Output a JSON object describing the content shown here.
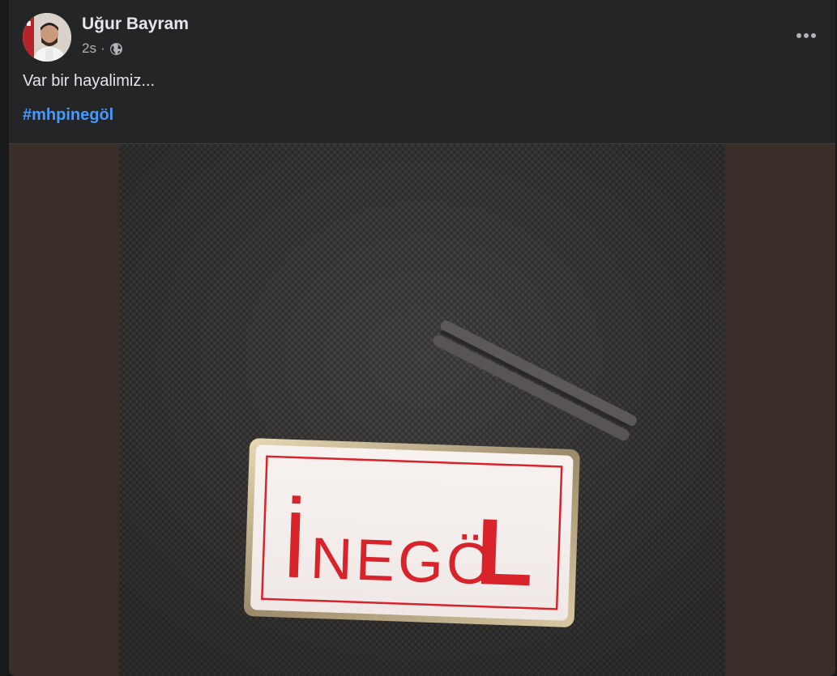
{
  "post": {
    "author": "Uğur Bayram",
    "time": "2s",
    "separator": "·",
    "text": "Var bir hayalimiz...",
    "hashtag": "#mhpinegöl"
  },
  "photo": {
    "pin_text_first": "İ",
    "pin_text_rest": "NEGÖ",
    "pin_text_last": "L"
  },
  "icons": {
    "privacy": "globe-icon",
    "menu": "more-options-icon"
  },
  "colors": {
    "card_bg": "#242526",
    "hashtag": "#4599ff",
    "pin_red": "#d9232a",
    "fabric": "#3d3c3b"
  }
}
